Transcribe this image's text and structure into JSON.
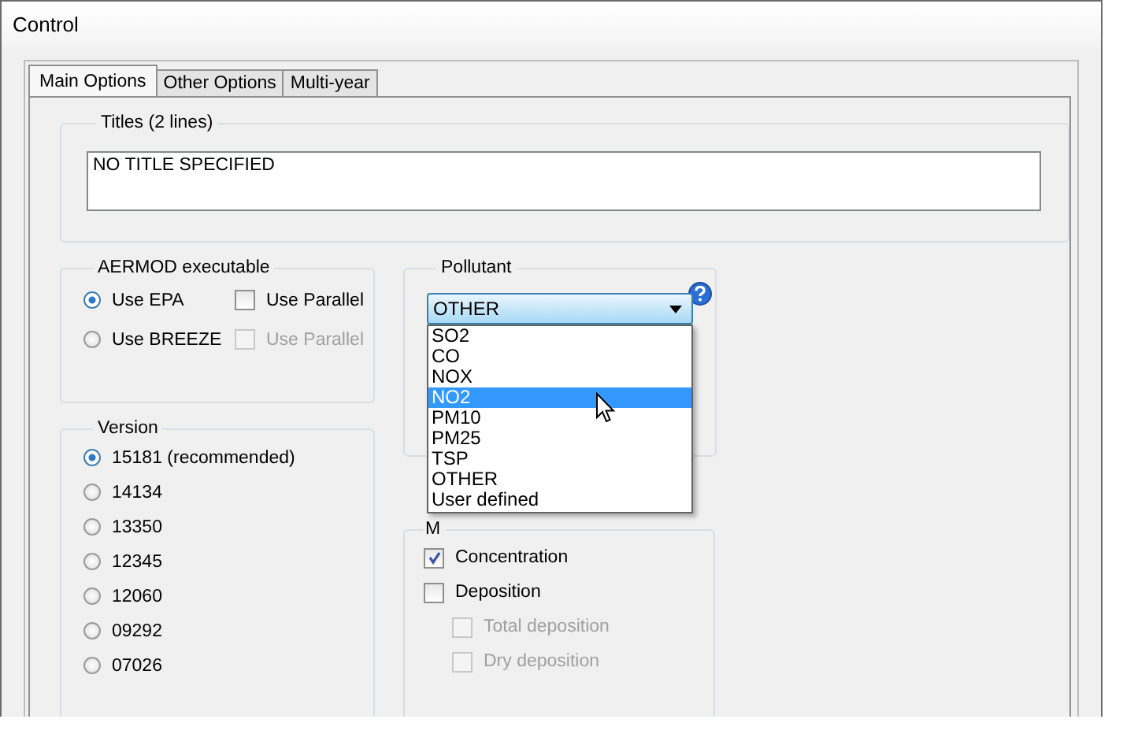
{
  "window": {
    "title": "Control"
  },
  "tabs": [
    {
      "label": "Main Options",
      "selected": true
    },
    {
      "label": "Other Options",
      "selected": false
    },
    {
      "label": "Multi-year",
      "selected": false
    }
  ],
  "titles": {
    "label": "Titles (2 lines)",
    "value": "NO TITLE SPECIFIED"
  },
  "executable": {
    "label": "AERMOD executable",
    "options": [
      {
        "label": "Use EPA",
        "selected": true,
        "parallel": {
          "label": "Use Parallel",
          "checked": false,
          "disabled": false
        }
      },
      {
        "label": "Use BREEZE",
        "selected": false,
        "parallel": {
          "label": "Use Parallel",
          "checked": false,
          "disabled": true
        }
      }
    ]
  },
  "version": {
    "label": "Version",
    "options": [
      {
        "label": "15181 (recommended)",
        "selected": true
      },
      {
        "label": "14134",
        "selected": false
      },
      {
        "label": "13350",
        "selected": false
      },
      {
        "label": "12345",
        "selected": false
      },
      {
        "label": "12060",
        "selected": false
      },
      {
        "label": "09292",
        "selected": false
      },
      {
        "label": "07026",
        "selected": false
      }
    ]
  },
  "pollutant": {
    "label": "Pollutant",
    "value": "OTHER",
    "expanded": true,
    "options": [
      {
        "label": "SO2",
        "highlighted": false
      },
      {
        "label": "CO",
        "highlighted": false
      },
      {
        "label": "NOX",
        "highlighted": false
      },
      {
        "label": "NO2",
        "highlighted": true
      },
      {
        "label": "PM10",
        "highlighted": false
      },
      {
        "label": "PM25",
        "highlighted": false
      },
      {
        "label": "TSP",
        "highlighted": false
      },
      {
        "label": "OTHER",
        "highlighted": false
      },
      {
        "label": "User defined",
        "highlighted": false
      }
    ]
  },
  "output": {
    "label": "M",
    "items": [
      {
        "label": "Concentration",
        "checked": true,
        "disabled": false,
        "indent": false
      },
      {
        "label": "Deposition",
        "checked": false,
        "disabled": false,
        "indent": false
      },
      {
        "label": "Total deposition",
        "checked": false,
        "disabled": true,
        "indent": true
      },
      {
        "label": "Dry deposition",
        "checked": false,
        "disabled": true,
        "indent": true
      }
    ]
  }
}
